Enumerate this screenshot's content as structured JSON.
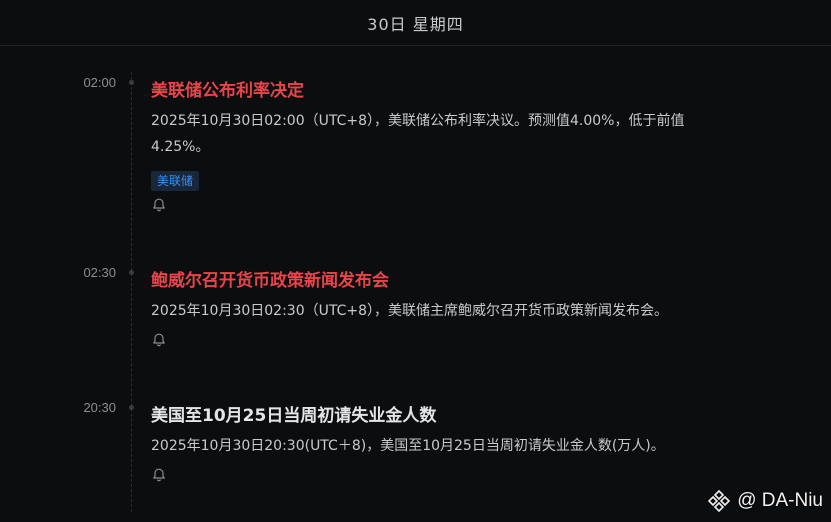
{
  "header": {
    "date_label": "30日  星期四"
  },
  "events": [
    {
      "time": "02:00",
      "title": "美联储公布利率决定",
      "title_color": "#e8454a",
      "description": "2025年10月30日02:00（UTC+8），美联储公布利率决议。预测值4.00%，低于前值4.25%。",
      "tag": "美联储",
      "icon": "bell-icon"
    },
    {
      "time": "02:30",
      "title": "鲍威尔召开货币政策新闻发布会",
      "title_color": "#e8454a",
      "description": "2025年10月30日02:30（UTC+8），美联储主席鲍威尔召开货币政策新闻发布会。",
      "icon": "bell-icon"
    },
    {
      "time": "20:30",
      "title": "美国至10月25日当周初请失业金人数",
      "title_color": "#e4e5e7",
      "description": "2025年10月30日20:30(UTC＋8)，美国至10月25日当周初请失业金人数(万人)。",
      "icon": "bell-icon"
    }
  ],
  "watermark": {
    "text": "@ DA-Niu",
    "logo_icon": "binance-logo-icon"
  }
}
